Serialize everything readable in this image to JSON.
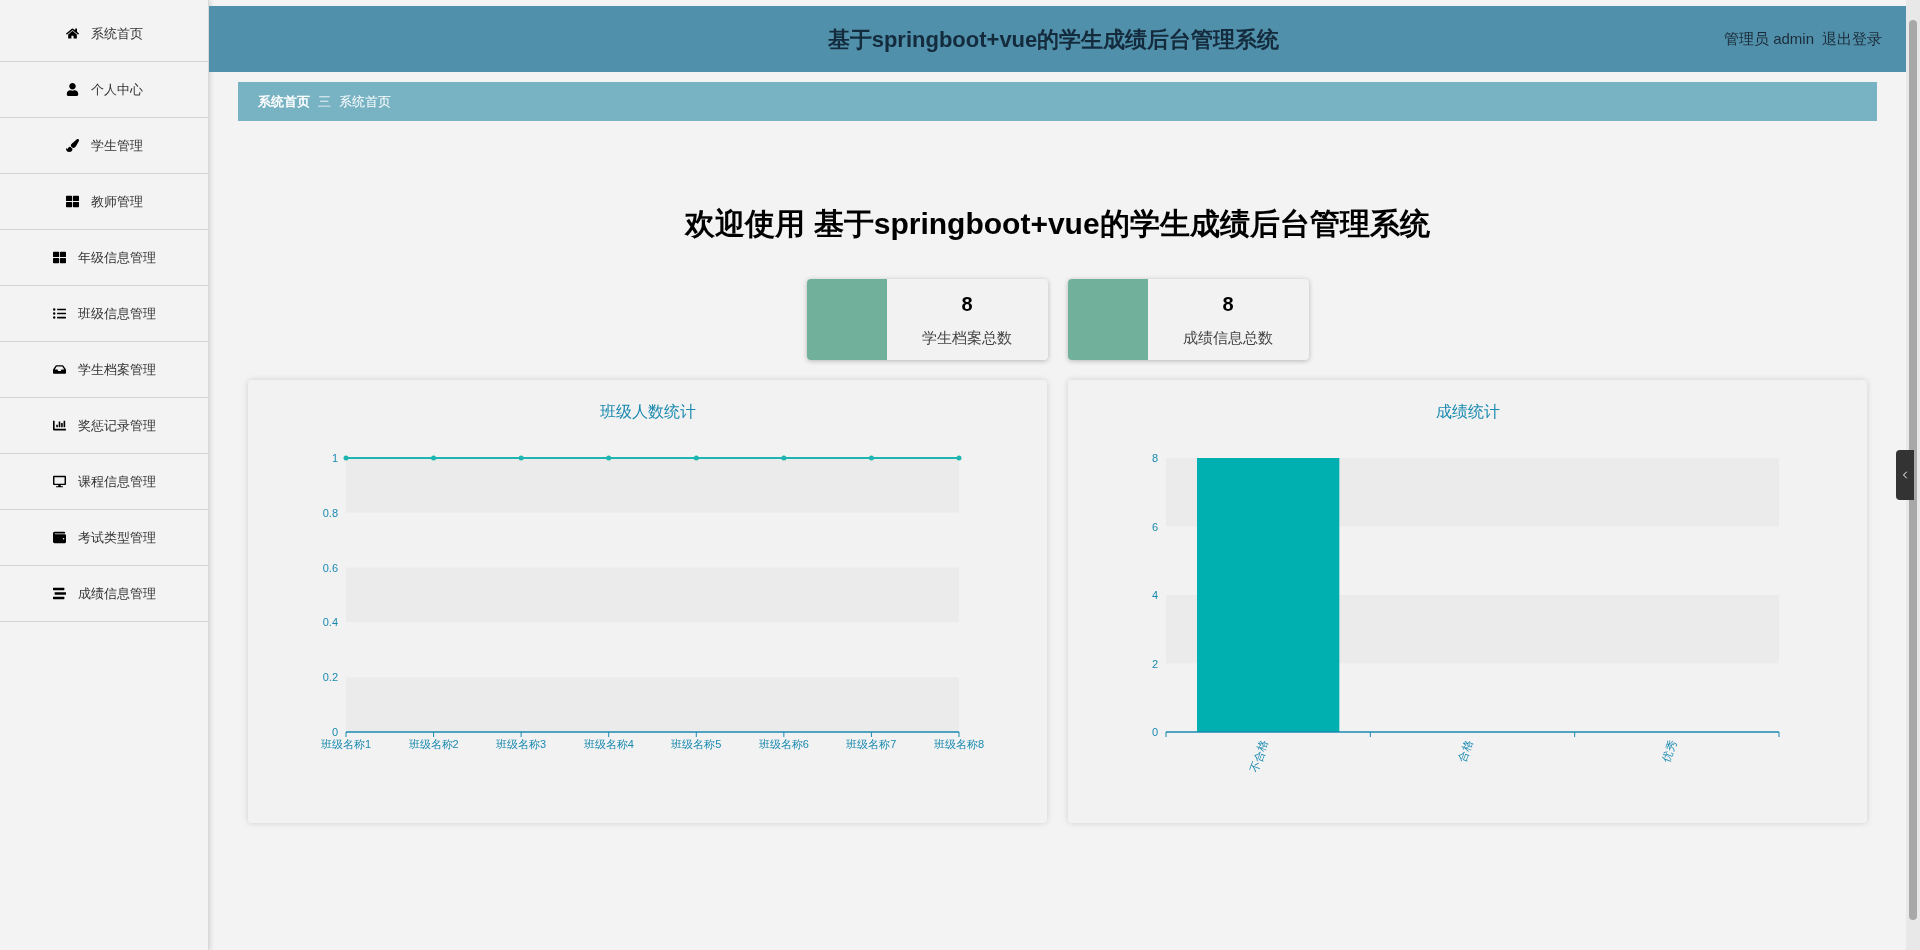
{
  "sidebar": {
    "items": [
      {
        "label": "系统首页"
      },
      {
        "label": "个人中心"
      },
      {
        "label": "学生管理"
      },
      {
        "label": "教师管理"
      },
      {
        "label": "年级信息管理"
      },
      {
        "label": "班级信息管理"
      },
      {
        "label": "学生档案管理"
      },
      {
        "label": "奖惩记录管理"
      },
      {
        "label": "课程信息管理"
      },
      {
        "label": "考试类型管理"
      },
      {
        "label": "成绩信息管理"
      }
    ]
  },
  "header": {
    "title": "基于springboot+vue的学生成绩后台管理系统",
    "user": "管理员 admin",
    "logout": "退出登录"
  },
  "breadcrumb": {
    "items": [
      "系统首页",
      "系统首页"
    ],
    "separator": "三"
  },
  "welcome": "欢迎使用 基于springboot+vue的学生成绩后台管理系统",
  "stats": [
    {
      "value": "8",
      "label": "学生档案总数",
      "color": "#71b09a"
    },
    {
      "value": "8",
      "label": "成绩信息总数",
      "color": "#71b09a"
    }
  ],
  "charts": [
    {
      "title": "班级人数统计",
      "chart_data": {
        "type": "line",
        "categories": [
          "班级名称1",
          "班级名称2",
          "班级名称3",
          "班级名称4",
          "班级名称5",
          "班级名称6",
          "班级名称7",
          "班级名称8"
        ],
        "series": [
          {
            "color": "#1fb5b0",
            "values": [
              1,
              1,
              1,
              1,
              1,
              1,
              1,
              1
            ]
          }
        ],
        "ylim": [
          0,
          1
        ],
        "yticks": [
          0,
          0.2,
          0.4,
          0.6,
          0.8,
          1
        ]
      }
    },
    {
      "title": "成绩统计",
      "chart_data": {
        "type": "bar",
        "categories": [
          "不合格",
          "合格",
          "优秀"
        ],
        "series": [
          {
            "color": "#00afb0",
            "values": [
              8,
              0,
              0
            ]
          }
        ],
        "ylim": [
          0,
          8
        ],
        "yticks": [
          0,
          2,
          4,
          6,
          8
        ]
      }
    }
  ]
}
